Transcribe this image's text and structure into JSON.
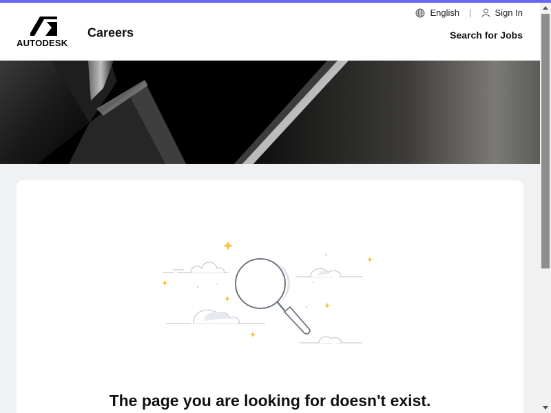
{
  "header": {
    "logo_text": "AUTODESK",
    "site_title": "Careers",
    "language_label": "English",
    "sign_in_label": "Sign In",
    "search_jobs_label": "Search for Jobs"
  },
  "icons": {
    "language": "globe-icon",
    "sign_in": "user-icon",
    "illustration": "magnifier-illustration"
  },
  "main": {
    "error_message": "The page you are looking for doesn't exist."
  },
  "colors": {
    "top_accent": "#6c66f0",
    "page_background": "#f0f1f3",
    "card_background": "#ffffff",
    "sparkle": "#f5c542"
  }
}
